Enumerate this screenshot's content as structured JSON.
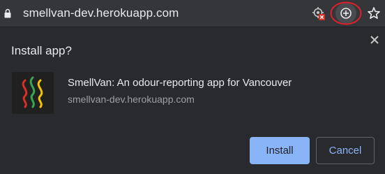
{
  "omnibox": {
    "url": "smellvan-dev.herokuapp.com",
    "icons": [
      "lock-icon",
      "location-blocked-icon",
      "install-app-icon",
      "bookmark-star-icon"
    ]
  },
  "dialog": {
    "title": "Install app?",
    "app_name": "SmellVan: An odour-reporting app for Vancouver",
    "app_domain": "smellvan-dev.herokuapp.com",
    "install_label": "Install",
    "cancel_label": "Cancel"
  },
  "colors": {
    "accent": "#8ab4f8",
    "highlight_ring": "#e0202a",
    "background": "#292a2d",
    "toolbar": "#35363a"
  }
}
